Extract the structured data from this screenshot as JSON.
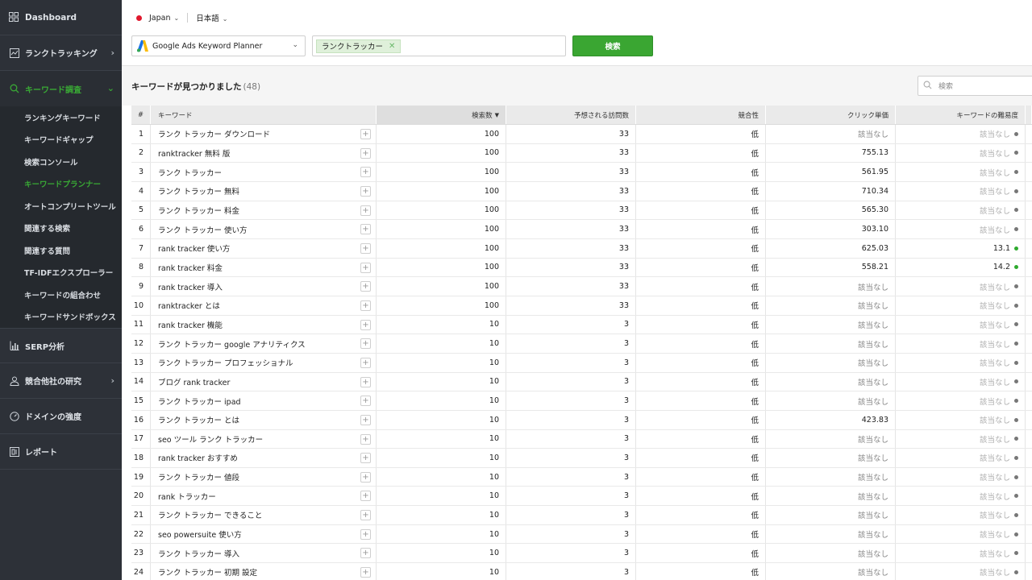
{
  "sidebar": {
    "dashboard": "Dashboard",
    "rank_tracking": "ランクトラッキング",
    "keyword_research": "キーワード調査",
    "keyword_research_items": [
      "ランキングキーワード",
      "キーワードギャップ",
      "検索コンソール",
      "キーワードプランナー",
      "オートコンプリートツール",
      "関連する検索",
      "関連する質問",
      "TF-IDFエクスプローラー",
      "キーワードの組合わせ",
      "キーワードサンドボックス"
    ],
    "serp": "SERP分析",
    "competitor": "競合他社の研究",
    "domain_strength": "ドメインの強度",
    "reports": "レポート"
  },
  "top": {
    "country": "Japan",
    "language": "日本語",
    "source": "Google Ads Keyword Planner",
    "tag": "ランクトラッカー",
    "search_button": "検索"
  },
  "results": {
    "title": "キーワードが見つかりました",
    "count": "(48)",
    "filter_placeholder": "検索"
  },
  "table": {
    "headers": {
      "num": "#",
      "keyword": "キーワード",
      "volume": "検索数",
      "visits": "予想される訪問数",
      "competition": "競合性",
      "cpc": "クリック単価",
      "difficulty": "キーワードの難易度"
    },
    "rows": [
      {
        "n": "1",
        "kw": "ランク トラッカー ダウンロード",
        "vol": "100",
        "vis": "33",
        "comp": "低",
        "cpc": "該当なし",
        "diff": "該当なし"
      },
      {
        "n": "2",
        "kw": "ranktracker 無料 版",
        "vol": "100",
        "vis": "33",
        "comp": "低",
        "cpc": "755.13",
        "diff": "該当なし"
      },
      {
        "n": "3",
        "kw": "ランク トラッカー",
        "vol": "100",
        "vis": "33",
        "comp": "低",
        "cpc": "561.95",
        "diff": "該当なし"
      },
      {
        "n": "4",
        "kw": "ランク トラッカー 無料",
        "vol": "100",
        "vis": "33",
        "comp": "低",
        "cpc": "710.34",
        "diff": "該当なし"
      },
      {
        "n": "5",
        "kw": "ランク トラッカー 料金",
        "vol": "100",
        "vis": "33",
        "comp": "低",
        "cpc": "565.30",
        "diff": "該当なし"
      },
      {
        "n": "6",
        "kw": "ランク トラッカー 使い方",
        "vol": "100",
        "vis": "33",
        "comp": "低",
        "cpc": "303.10",
        "diff": "該当なし"
      },
      {
        "n": "7",
        "kw": "rank tracker 使い方",
        "vol": "100",
        "vis": "33",
        "comp": "低",
        "cpc": "625.03",
        "diff": "13.1"
      },
      {
        "n": "8",
        "kw": "rank tracker 料金",
        "vol": "100",
        "vis": "33",
        "comp": "低",
        "cpc": "558.21",
        "diff": "14.2"
      },
      {
        "n": "9",
        "kw": "rank tracker 導入",
        "vol": "100",
        "vis": "33",
        "comp": "低",
        "cpc": "該当なし",
        "diff": "該当なし"
      },
      {
        "n": "10",
        "kw": "ranktracker とは",
        "vol": "100",
        "vis": "33",
        "comp": "低",
        "cpc": "該当なし",
        "diff": "該当なし"
      },
      {
        "n": "11",
        "kw": "rank tracker 機能",
        "vol": "10",
        "vis": "3",
        "comp": "低",
        "cpc": "該当なし",
        "diff": "該当なし"
      },
      {
        "n": "12",
        "kw": "ランク トラッカー google アナリティクス",
        "vol": "10",
        "vis": "3",
        "comp": "低",
        "cpc": "該当なし",
        "diff": "該当なし"
      },
      {
        "n": "13",
        "kw": "ランク トラッカー プロフェッショナル",
        "vol": "10",
        "vis": "3",
        "comp": "低",
        "cpc": "該当なし",
        "diff": "該当なし"
      },
      {
        "n": "14",
        "kw": "ブログ rank tracker",
        "vol": "10",
        "vis": "3",
        "comp": "低",
        "cpc": "該当なし",
        "diff": "該当なし"
      },
      {
        "n": "15",
        "kw": "ランク トラッカー ipad",
        "vol": "10",
        "vis": "3",
        "comp": "低",
        "cpc": "該当なし",
        "diff": "該当なし"
      },
      {
        "n": "16",
        "kw": "ランク トラッカー とは",
        "vol": "10",
        "vis": "3",
        "comp": "低",
        "cpc": "423.83",
        "diff": "該当なし"
      },
      {
        "n": "17",
        "kw": "seo ツール ランク トラッカー",
        "vol": "10",
        "vis": "3",
        "comp": "低",
        "cpc": "該当なし",
        "diff": "該当なし"
      },
      {
        "n": "18",
        "kw": "rank tracker おすすめ",
        "vol": "10",
        "vis": "3",
        "comp": "低",
        "cpc": "該当なし",
        "diff": "該当なし"
      },
      {
        "n": "19",
        "kw": "ランク トラッカー 値段",
        "vol": "10",
        "vis": "3",
        "comp": "低",
        "cpc": "該当なし",
        "diff": "該当なし"
      },
      {
        "n": "20",
        "kw": "rank トラッカー",
        "vol": "10",
        "vis": "3",
        "comp": "低",
        "cpc": "該当なし",
        "diff": "該当なし"
      },
      {
        "n": "21",
        "kw": "ランク トラッカー できること",
        "vol": "10",
        "vis": "3",
        "comp": "低",
        "cpc": "該当なし",
        "diff": "該当なし"
      },
      {
        "n": "22",
        "kw": "seo powersuite 使い方",
        "vol": "10",
        "vis": "3",
        "comp": "低",
        "cpc": "該当なし",
        "diff": "該当なし"
      },
      {
        "n": "23",
        "kw": "ランク トラッカー 導入",
        "vol": "10",
        "vis": "3",
        "comp": "低",
        "cpc": "該当なし",
        "diff": "該当なし"
      },
      {
        "n": "24",
        "kw": "ランク トラッカー 初期 設定",
        "vol": "10",
        "vis": "3",
        "comp": "低",
        "cpc": "該当なし",
        "diff": "該当なし"
      }
    ]
  },
  "colors": {
    "accent": "#39a935",
    "sidebar_bg": "#2d3138",
    "difficulty_good": "#2eaa2e",
    "difficulty_na": "#777777"
  }
}
